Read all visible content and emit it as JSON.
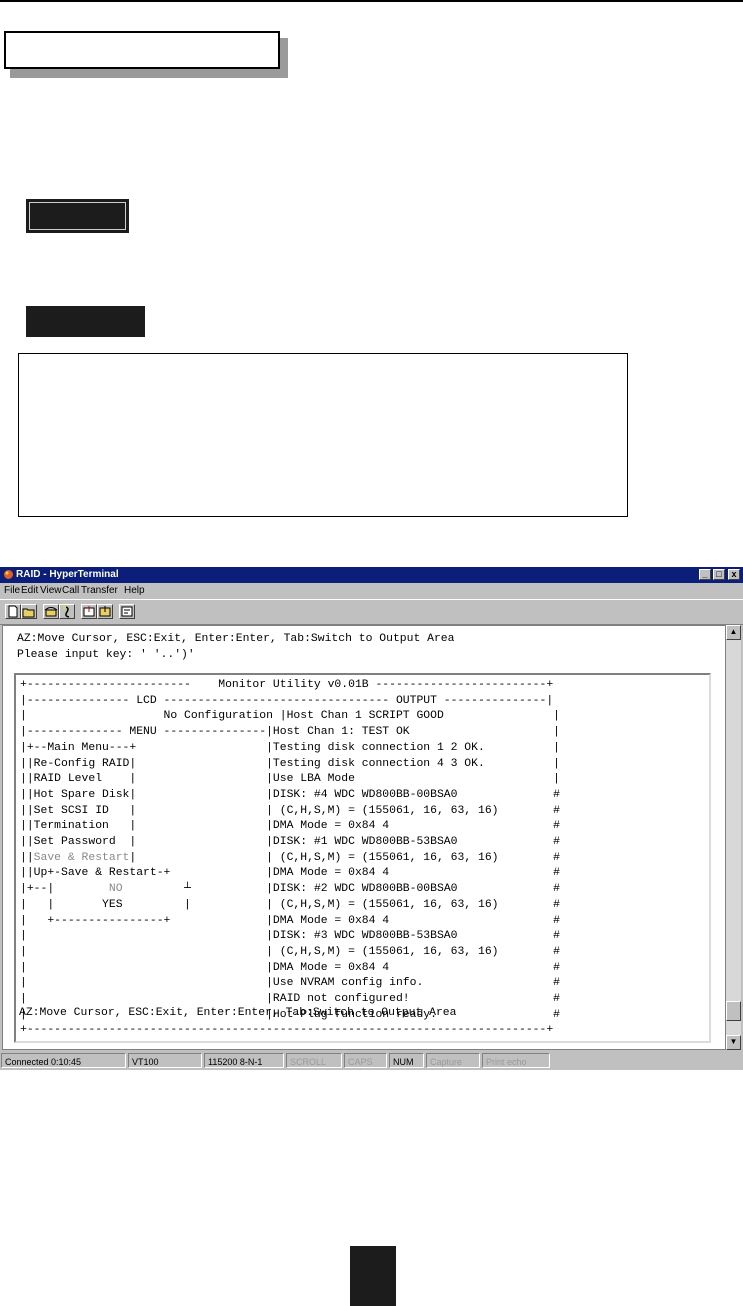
{
  "window": {
    "title": "RAID - HyperTerminal",
    "controls": [
      "_",
      "□",
      "x"
    ]
  },
  "menu": [
    "File",
    "Edit",
    "View",
    "Call",
    "Transfer",
    "Help"
  ],
  "toolbar": {
    "buttons": [
      "new-icon",
      "open-icon",
      "phone-icon",
      "disconnect-icon",
      "send-icon",
      "receive-icon",
      "properties-icon"
    ]
  },
  "terminal": {
    "header_line1": "AZ:Move Cursor, ESC:Exit, Enter:Enter, Tab:Switch to Output Area",
    "header_line2": "Please input key: ' '..')'",
    "frame_rows": [
      "+------------------------    Monitor Utility v0.01B -------------------------+",
      "|--------------- LCD --------------------------------- OUTPUT ---------------|",
      "|                    No Configuration |Host Chan 1 SCRIPT GOOD                |",
      "|-------------- MENU ---------------|Host Chan 1: TEST OK                     |",
      "|+--Main Menu---+                   |Testing disk connection 1 2 OK.          |",
      "||Re-Config RAID|                   |Testing disk connection 4 3 OK.          |",
      "||RAID Level    |                   |Use LBA Mode                             |",
      "||Hot Spare Disk|                   |DISK: #4 WDC WD800BB-00BSA0              #",
      "||Set SCSI ID   |                   | (C,H,S,M) = (155061, 16, 63, 16)        #",
      "||Termination   |                   |DMA Mode = 0x84 4                        #",
      "||Set Password  |                   |DISK: #1 WDC WD800BB-53BSA0              #",
      "||Save & Restart|                   | (C,H,S,M) = (155061, 16, 63, 16)        #",
      "||Up+-Save & Restart-+              |DMA Mode = 0x84 4                        #",
      "|+--|        NO         ┴           |DISK: #2 WDC WD800BB-00BSA0              #",
      "|   |       YES         |           | (C,H,S,M) = (155061, 16, 63, 16)        #",
      "|   +----------------+              |DMA Mode = 0x84 4                        #",
      "|                                   |DISK: #3 WDC WD800BB-53BSA0              #",
      "|                                   | (C,H,S,M) = (155061, 16, 63, 16)        #",
      "|                                   |DMA Mode = 0x84 4                        #",
      "|                                   |Use NVRAM config info.                   #",
      "|                                   |RAID not configured!                     #",
      "|                                   |Hot-Plug function ready.                 #",
      "+----------------------------------------------------------------------------+",
      "AZ:Move Cursor, ESC:Exit, Enter:Enter, Tab:Switch to Output Area"
    ]
  },
  "statusbar": {
    "connected": "Connected 0:10:45",
    "emulation": "VT100",
    "settings": "115200 8-N-1",
    "scroll": "SCROLL",
    "caps": "CAPS",
    "num": "NUM",
    "capture": "Capture",
    "print_echo": "Print echo"
  },
  "colors": {
    "titlebar": "#0a1e7a",
    "chrome": "#c0c0c0",
    "label_dark": "#1c1c1c"
  }
}
